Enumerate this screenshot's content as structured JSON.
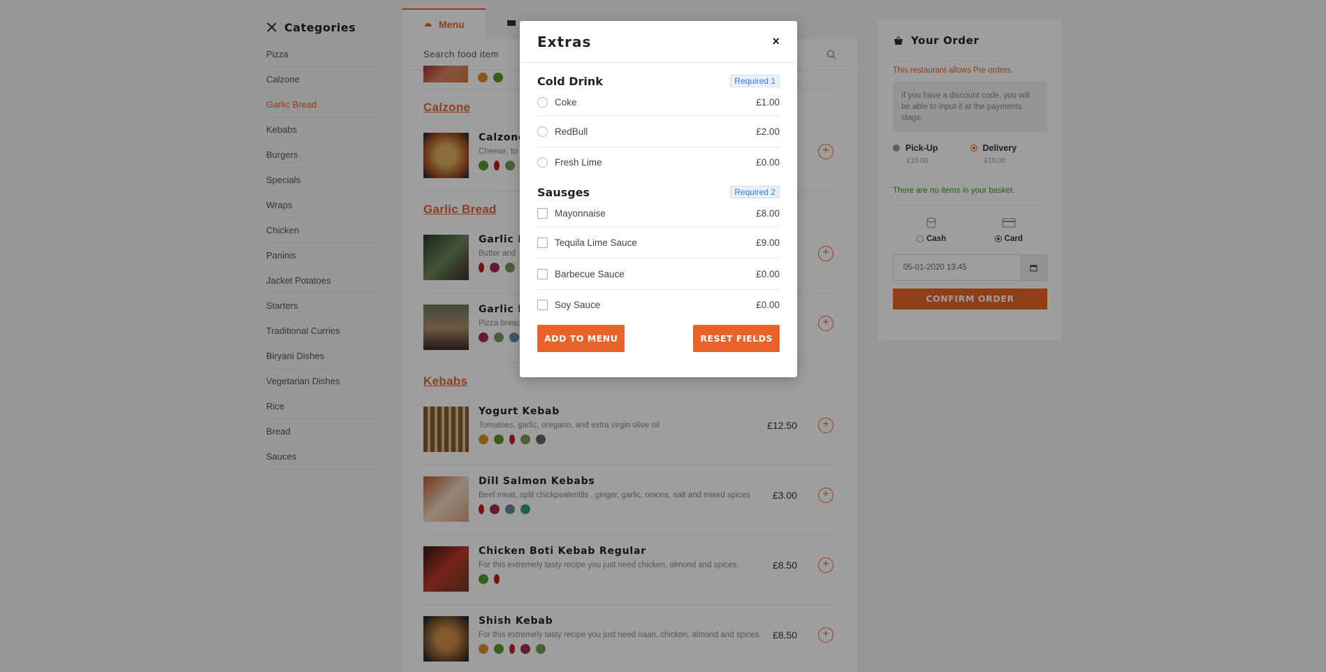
{
  "sidebar": {
    "title": "Categories",
    "items": [
      "Pizza",
      "Calzone",
      "Garlic Bread",
      "Kebabs",
      "Burgers",
      "Specials",
      "Wraps",
      "Chicken",
      "Paninis",
      "Jacket Potatoes",
      "Starters",
      "Traditional Curries",
      "Biryani Dishes",
      "Vegetarian Dishes",
      "Rice",
      "Bread",
      "Sauces"
    ],
    "active": "Garlic Bread"
  },
  "tabs": {
    "menu": "Menu"
  },
  "search": {
    "placeholder": "Search food item"
  },
  "sections": [
    {
      "title": "Calzone",
      "items": [
        {
          "name": "Calzone",
          "desc": "Cheese, to",
          "price": ""
        }
      ]
    },
    {
      "title": "Garlic Bread",
      "items": [
        {
          "name": "Garlic B",
          "desc": "Butter and",
          "price": ""
        },
        {
          "name": "Garlic B",
          "desc": "Pizza bread",
          "price": ""
        }
      ]
    },
    {
      "title": "Kebabs",
      "items": [
        {
          "name": "Yogurt Kebab",
          "desc": "Tomatoes, garlic, oregano, and extra virgin olive oil",
          "price": "£12.50"
        },
        {
          "name": "Dill Salmon Kebabs",
          "desc": "Beef meat, split chickpealentils , ginger, garlic, onions, salt and mixed spices",
          "price": "£3.00"
        },
        {
          "name": "Chicken Boti Kebab Regular",
          "desc": "For this extremely tasty recipe you just need chicken, almond and spices.",
          "price": "£8.50"
        },
        {
          "name": "Shish Kebab",
          "desc": "For this extremely tasty recipe you just need naan, chicken, almond and spices.",
          "price": "£8.50"
        }
      ]
    }
  ],
  "order": {
    "title": "Your Order",
    "preorder": "This restaurant allows Pre orders.",
    "discount": "If you have a discount code, you will be able to input it at the payments stage.",
    "pickup": {
      "label": "Pick-Up",
      "fee": "£10.00"
    },
    "delivery": {
      "label": "Delivery",
      "fee": "£10.00"
    },
    "empty": "There are no items in your basket.",
    "cash": "Cash",
    "card": "Card",
    "date": "05-01-2020 13:45",
    "confirm": "CONFIRM ORDER"
  },
  "modal": {
    "title": "Extras",
    "close": "×",
    "groups": [
      {
        "name": "Cold Drink",
        "required": "Required 1",
        "type": "radio",
        "options": [
          {
            "label": "Coke",
            "price": "£1.00"
          },
          {
            "label": "RedBull",
            "price": "£2.00"
          },
          {
            "label": "Fresh Lime",
            "price": "£0.00"
          }
        ]
      },
      {
        "name": "Sausges",
        "required": "Required 2",
        "type": "checkbox",
        "options": [
          {
            "label": "Mayonnaise",
            "price": "£8.00"
          },
          {
            "label": "Tequila Lime Sauce",
            "price": "£9.00"
          },
          {
            "label": "Barbecue Sauce",
            "price": "£0.00"
          },
          {
            "label": "Soy Sauce",
            "price": "£0.00"
          }
        ]
      }
    ],
    "add_label": "ADD TO MENU",
    "reset_label": "RESET FIELDS"
  },
  "colors": {
    "accent": "#e8632a",
    "success": "#3c9a1a",
    "info": "#3a7cc4"
  }
}
